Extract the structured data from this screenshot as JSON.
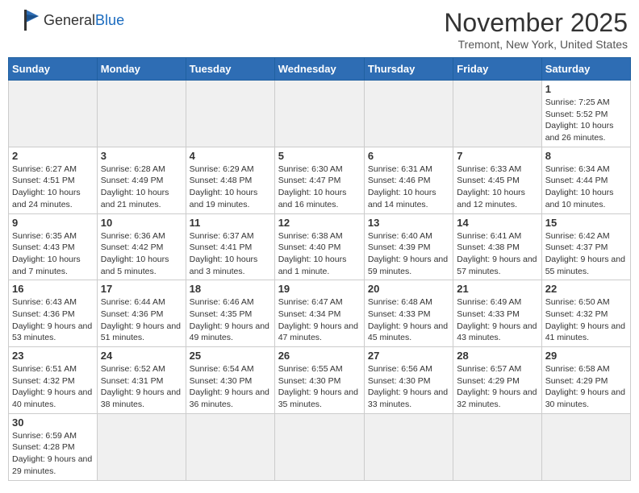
{
  "header": {
    "logo_general": "General",
    "logo_blue": "Blue",
    "month_title": "November 2025",
    "subtitle": "Tremont, New York, United States"
  },
  "weekdays": [
    "Sunday",
    "Monday",
    "Tuesday",
    "Wednesday",
    "Thursday",
    "Friday",
    "Saturday"
  ],
  "weeks": [
    [
      {
        "day": "",
        "info": ""
      },
      {
        "day": "",
        "info": ""
      },
      {
        "day": "",
        "info": ""
      },
      {
        "day": "",
        "info": ""
      },
      {
        "day": "",
        "info": ""
      },
      {
        "day": "",
        "info": ""
      },
      {
        "day": "1",
        "info": "Sunrise: 7:25 AM\nSunset: 5:52 PM\nDaylight: 10 hours and 26 minutes."
      }
    ],
    [
      {
        "day": "2",
        "info": "Sunrise: 6:27 AM\nSunset: 4:51 PM\nDaylight: 10 hours and 24 minutes."
      },
      {
        "day": "3",
        "info": "Sunrise: 6:28 AM\nSunset: 4:49 PM\nDaylight: 10 hours and 21 minutes."
      },
      {
        "day": "4",
        "info": "Sunrise: 6:29 AM\nSunset: 4:48 PM\nDaylight: 10 hours and 19 minutes."
      },
      {
        "day": "5",
        "info": "Sunrise: 6:30 AM\nSunset: 4:47 PM\nDaylight: 10 hours and 16 minutes."
      },
      {
        "day": "6",
        "info": "Sunrise: 6:31 AM\nSunset: 4:46 PM\nDaylight: 10 hours and 14 minutes."
      },
      {
        "day": "7",
        "info": "Sunrise: 6:33 AM\nSunset: 4:45 PM\nDaylight: 10 hours and 12 minutes."
      },
      {
        "day": "8",
        "info": "Sunrise: 6:34 AM\nSunset: 4:44 PM\nDaylight: 10 hours and 10 minutes."
      }
    ],
    [
      {
        "day": "9",
        "info": "Sunrise: 6:35 AM\nSunset: 4:43 PM\nDaylight: 10 hours and 7 minutes."
      },
      {
        "day": "10",
        "info": "Sunrise: 6:36 AM\nSunset: 4:42 PM\nDaylight: 10 hours and 5 minutes."
      },
      {
        "day": "11",
        "info": "Sunrise: 6:37 AM\nSunset: 4:41 PM\nDaylight: 10 hours and 3 minutes."
      },
      {
        "day": "12",
        "info": "Sunrise: 6:38 AM\nSunset: 4:40 PM\nDaylight: 10 hours and 1 minute."
      },
      {
        "day": "13",
        "info": "Sunrise: 6:40 AM\nSunset: 4:39 PM\nDaylight: 9 hours and 59 minutes."
      },
      {
        "day": "14",
        "info": "Sunrise: 6:41 AM\nSunset: 4:38 PM\nDaylight: 9 hours and 57 minutes."
      },
      {
        "day": "15",
        "info": "Sunrise: 6:42 AM\nSunset: 4:37 PM\nDaylight: 9 hours and 55 minutes."
      }
    ],
    [
      {
        "day": "16",
        "info": "Sunrise: 6:43 AM\nSunset: 4:36 PM\nDaylight: 9 hours and 53 minutes."
      },
      {
        "day": "17",
        "info": "Sunrise: 6:44 AM\nSunset: 4:36 PM\nDaylight: 9 hours and 51 minutes."
      },
      {
        "day": "18",
        "info": "Sunrise: 6:46 AM\nSunset: 4:35 PM\nDaylight: 9 hours and 49 minutes."
      },
      {
        "day": "19",
        "info": "Sunrise: 6:47 AM\nSunset: 4:34 PM\nDaylight: 9 hours and 47 minutes."
      },
      {
        "day": "20",
        "info": "Sunrise: 6:48 AM\nSunset: 4:33 PM\nDaylight: 9 hours and 45 minutes."
      },
      {
        "day": "21",
        "info": "Sunrise: 6:49 AM\nSunset: 4:33 PM\nDaylight: 9 hours and 43 minutes."
      },
      {
        "day": "22",
        "info": "Sunrise: 6:50 AM\nSunset: 4:32 PM\nDaylight: 9 hours and 41 minutes."
      }
    ],
    [
      {
        "day": "23",
        "info": "Sunrise: 6:51 AM\nSunset: 4:32 PM\nDaylight: 9 hours and 40 minutes."
      },
      {
        "day": "24",
        "info": "Sunrise: 6:52 AM\nSunset: 4:31 PM\nDaylight: 9 hours and 38 minutes."
      },
      {
        "day": "25",
        "info": "Sunrise: 6:54 AM\nSunset: 4:30 PM\nDaylight: 9 hours and 36 minutes."
      },
      {
        "day": "26",
        "info": "Sunrise: 6:55 AM\nSunset: 4:30 PM\nDaylight: 9 hours and 35 minutes."
      },
      {
        "day": "27",
        "info": "Sunrise: 6:56 AM\nSunset: 4:30 PM\nDaylight: 9 hours and 33 minutes."
      },
      {
        "day": "28",
        "info": "Sunrise: 6:57 AM\nSunset: 4:29 PM\nDaylight: 9 hours and 32 minutes."
      },
      {
        "day": "29",
        "info": "Sunrise: 6:58 AM\nSunset: 4:29 PM\nDaylight: 9 hours and 30 minutes."
      }
    ],
    [
      {
        "day": "30",
        "info": "Sunrise: 6:59 AM\nSunset: 4:28 PM\nDaylight: 9 hours and 29 minutes."
      },
      {
        "day": "",
        "info": ""
      },
      {
        "day": "",
        "info": ""
      },
      {
        "day": "",
        "info": ""
      },
      {
        "day": "",
        "info": ""
      },
      {
        "day": "",
        "info": ""
      },
      {
        "day": "",
        "info": ""
      }
    ]
  ]
}
